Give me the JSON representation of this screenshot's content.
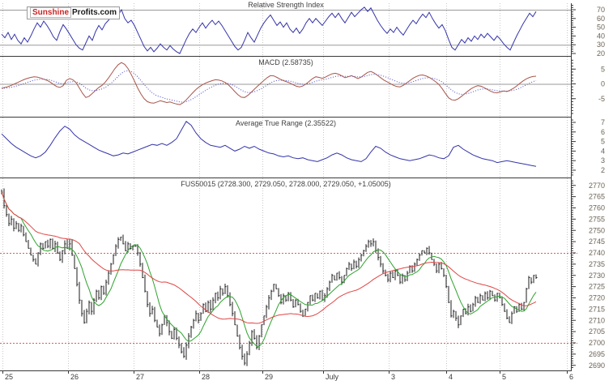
{
  "logo": {
    "part1": "Sunshine",
    "part2": "Profits.com"
  },
  "colors": {
    "rsi_line": "#3434aa",
    "macd_line": "#a8554a",
    "macd_signal": "#4747cc",
    "atr_line": "#3434aa",
    "price_bar": "#1b1b1b",
    "ma_fast": "#2da32d",
    "ma_slow": "#e04545",
    "hline": "#d85c5c",
    "ref_line": "#9a9a9a",
    "grid_line": "#c8c8c8",
    "separator": "#3a3a3a",
    "axis": "#3a3a3a",
    "tick_label": "#6b6255",
    "date_label": "#3a3a3a"
  },
  "x_axis": {
    "labels": [
      "25",
      "26",
      "27",
      "28",
      "29",
      "July",
      "3",
      "4",
      "5",
      "6"
    ],
    "positions": [
      3,
      84,
      165,
      246,
      324,
      399,
      480,
      551,
      617,
      700
    ]
  },
  "chart_data": [
    {
      "type": "line",
      "panel": "rsi",
      "title": "Relative Strength Index",
      "ylim": [
        18,
        75
      ],
      "yticks": [
        70,
        60,
        50,
        40,
        30,
        20
      ],
      "ref_lines": [
        70,
        30
      ],
      "grid": "vertical-dotted",
      "legend_position": "none",
      "series": [
        {
          "name": "RSI",
          "color_key": "rsi_line",
          "x0": 2,
          "dx": 4,
          "values": [
            42,
            38,
            44,
            36,
            42,
            35,
            31,
            38,
            33,
            40,
            48,
            55,
            50,
            57,
            52,
            46,
            39,
            35,
            45,
            53,
            48,
            42,
            36,
            30,
            26,
            24,
            32,
            40,
            35,
            45,
            52,
            47,
            54,
            58,
            63,
            68,
            64,
            70,
            60,
            55,
            58,
            52,
            44,
            36,
            28,
            23,
            27,
            22,
            26,
            31,
            27,
            24,
            29,
            25,
            22,
            20,
            28,
            36,
            43,
            48,
            44,
            50,
            55,
            49,
            54,
            58,
            53,
            57,
            52,
            46,
            40,
            34,
            28,
            24,
            27,
            35,
            44,
            38,
            33,
            41,
            49,
            55,
            60,
            64,
            58,
            52,
            56,
            50,
            55,
            48,
            44,
            49,
            43,
            48,
            55,
            60,
            55,
            60,
            56,
            52,
            57,
            62,
            66,
            61,
            66,
            60,
            55,
            61,
            67,
            62,
            66,
            70,
            73,
            68,
            72,
            65,
            58,
            52,
            47,
            43,
            48,
            44,
            50,
            45,
            41,
            47,
            53,
            58,
            54,
            60,
            65,
            61,
            67,
            60,
            54,
            49,
            53,
            46,
            36,
            27,
            24,
            30,
            36,
            32,
            38,
            34,
            40,
            36,
            42,
            38,
            43,
            39,
            35,
            40,
            36,
            31,
            27,
            24,
            32,
            40,
            47,
            54,
            60,
            66,
            62,
            68
          ]
        }
      ]
    },
    {
      "type": "line",
      "panel": "macd",
      "title": "MACD (2.58735)",
      "current_value": 2.58735,
      "ylim": [
        -10,
        10
      ],
      "yticks": [
        5,
        0,
        -5
      ],
      "ref_lines": [
        0
      ],
      "legend_position": "none",
      "series": [
        {
          "name": "MACD line",
          "color_key": "macd_line",
          "x0": 2,
          "dx": 4,
          "values": [
            -1.5,
            -1.2,
            -0.9,
            -0.5,
            0.0,
            0.5,
            1.0,
            1.5,
            1.9,
            2.2,
            2.4,
            2.3,
            2.0,
            1.6,
            1.2,
            0.6,
            -0.2,
            -0.9,
            -1.2,
            -0.6,
            1.2,
            1.8,
            1.4,
            0.4,
            -1.4,
            -3.2,
            -4.6,
            -4.2,
            -3.2,
            -2.2,
            -1.2,
            -0.5,
            0.6,
            2.0,
            3.6,
            5.2,
            6.5,
            7.2,
            6.6,
            5.2,
            3.2,
            1.0,
            -1.4,
            -3.4,
            -5.0,
            -6.0,
            -6.4,
            -6.5,
            -6.1,
            -5.7,
            -6.0,
            -6.3,
            -6.1,
            -6.5,
            -6.8,
            -7.0,
            -6.4,
            -5.4,
            -4.2,
            -3.0,
            -1.9,
            -1.0,
            -0.3,
            0.3,
            0.7,
            1.1,
            1.4,
            1.3,
            1.0,
            0.5,
            -0.3,
            -1.4,
            -2.6,
            -3.7,
            -4.5,
            -4.6,
            -3.9,
            -2.9,
            -1.8,
            -0.8,
            0.2,
            1.2,
            2.1,
            2.8,
            2.7,
            2.2,
            1.6,
            1.1,
            0.7,
            0.3,
            -0.3,
            -0.8,
            -1.0,
            -0.7,
            0.0,
            0.9,
            1.8,
            2.4,
            2.2,
            1.9,
            2.3,
            2.9,
            3.4,
            3.6,
            3.3,
            2.7,
            2.1,
            2.4,
            2.8,
            2.3,
            1.8,
            2.3,
            3.1,
            3.9,
            4.2,
            3.7,
            2.9,
            2.1,
            1.3,
            0.7,
            0.1,
            -0.5,
            -0.9,
            -1.0,
            -0.5,
            0.3,
            1.1,
            1.9,
            2.5,
            2.9,
            3.0,
            2.7,
            2.2,
            1.5,
            0.7,
            -0.2,
            -1.6,
            -3.2,
            -4.7,
            -5.4,
            -5.5,
            -5.0,
            -4.2,
            -3.3,
            -2.4,
            -1.6,
            -1.0,
            -0.6,
            -0.8,
            -1.3,
            -1.9,
            -2.5,
            -2.9,
            -3.0,
            -2.7,
            -2.4,
            -2.6,
            -2.1,
            -1.5,
            -0.7,
            0.2,
            1.0,
            1.7,
            2.2,
            2.5,
            2.6
          ]
        },
        {
          "name": "signal line",
          "type": "derived_ema",
          "alpha": 0.22,
          "color_key": "macd_signal",
          "dash": "1 2"
        }
      ]
    },
    {
      "type": "line",
      "panel": "atr",
      "title": "Average True Range (2.35522)",
      "current_value": 2.35522,
      "ylim": [
        1.9,
        7.5
      ],
      "yticks": [
        7,
        6,
        5,
        4,
        3,
        2
      ],
      "ref_lines": [],
      "legend_position": "none",
      "series": [
        {
          "name": "ATR",
          "color_key": "atr_line",
          "x0": 2,
          "dx": 6,
          "values": [
            5.8,
            5.3,
            4.8,
            4.4,
            4.1,
            3.8,
            3.5,
            3.3,
            3.5,
            3.9,
            4.6,
            5.4,
            6.1,
            6.6,
            6.3,
            5.7,
            5.3,
            5.0,
            4.7,
            4.4,
            4.1,
            3.9,
            3.7,
            3.5,
            3.6,
            3.8,
            3.7,
            3.9,
            4.1,
            4.3,
            4.5,
            4.7,
            4.6,
            4.8,
            4.6,
            4.9,
            5.3,
            6.2,
            7.1,
            6.7,
            5.9,
            5.3,
            4.9,
            4.6,
            4.5,
            4.4,
            4.6,
            4.3,
            4.0,
            4.2,
            4.5,
            4.3,
            4.5,
            4.2,
            4.0,
            3.8,
            3.7,
            3.5,
            3.4,
            3.5,
            3.3,
            3.2,
            3.3,
            3.1,
            3.0,
            2.9,
            3.1,
            3.3,
            3.6,
            3.8,
            3.6,
            3.3,
            3.1,
            3.0,
            2.9,
            3.2,
            3.9,
            4.5,
            4.3,
            3.9,
            3.6,
            3.4,
            3.2,
            3.1,
            3.0,
            3.1,
            3.2,
            3.4,
            3.6,
            3.5,
            3.3,
            3.2,
            3.5,
            4.4,
            4.6,
            4.2,
            3.9,
            3.6,
            3.4,
            3.2,
            3.1,
            3.0,
            2.8,
            2.9,
            3.0,
            2.9,
            2.8,
            2.7,
            2.6,
            2.5,
            2.4
          ]
        }
      ]
    },
    {
      "type": "ohlc",
      "panel": "price",
      "title": "FUS50015 (2728.300, 2729.050, 2728.000, 2729.050, +1.05005)",
      "symbol": "FUS50015",
      "last_values": {
        "open": "2728.300",
        "high": "2729.050",
        "low": "2728.000",
        "close": "2729.050",
        "change": "+1.05005"
      },
      "ylim": [
        2688,
        2772
      ],
      "yticks": [
        2770,
        2765,
        2760,
        2755,
        2750,
        2745,
        2740,
        2735,
        2730,
        2725,
        2720,
        2715,
        2710,
        2705,
        2700,
        2695,
        2690
      ],
      "hlines": [
        {
          "value": 2740,
          "style": "dotted"
        },
        {
          "value": 2700,
          "style": "dotted"
        }
      ],
      "legend_position": "none",
      "series": [
        {
          "name": "FUS500 15-min bars",
          "type": "bars",
          "color_key": "price_bar",
          "x0": 2,
          "dx": 3,
          "closes": [
            2767,
            2761,
            2757,
            2753,
            2755,
            2751,
            2753,
            2750,
            2752,
            2748,
            2745,
            2742,
            2739,
            2737,
            2735,
            2740,
            2744,
            2742,
            2745,
            2743,
            2746,
            2742,
            2744,
            2740,
            2737,
            2741,
            2744,
            2742,
            2744,
            2739,
            2733,
            2726,
            2719,
            2713,
            2709,
            2714,
            2718,
            2714,
            2719,
            2723,
            2720,
            2725,
            2722,
            2727,
            2731,
            2735,
            2739,
            2743,
            2746,
            2747,
            2744,
            2741,
            2744,
            2742,
            2743,
            2743,
            2740,
            2735,
            2729,
            2723,
            2717,
            2713,
            2715,
            2710,
            2707,
            2704,
            2708,
            2712,
            2709,
            2705,
            2702,
            2706,
            2702,
            2699,
            2696,
            2694,
            2699,
            2703,
            2707,
            2710,
            2713,
            2710,
            2713,
            2717,
            2714,
            2718,
            2715,
            2719,
            2722,
            2720,
            2724,
            2722,
            2725,
            2721,
            2717,
            2713,
            2708,
            2703,
            2698,
            2694,
            2691,
            2695,
            2700,
            2705,
            2702,
            2698,
            2703,
            2708,
            2712,
            2716,
            2720,
            2723,
            2726,
            2724,
            2721,
            2718,
            2721,
            2719,
            2722,
            2719,
            2716,
            2719,
            2717,
            2714,
            2712,
            2715,
            2718,
            2721,
            2719,
            2722,
            2720,
            2723,
            2719,
            2721,
            2724,
            2727,
            2730,
            2728,
            2731,
            2729,
            2727,
            2730,
            2733,
            2735,
            2733,
            2736,
            2734,
            2737,
            2739,
            2741,
            2743,
            2745,
            2744,
            2745,
            2741,
            2738,
            2735,
            2732,
            2730,
            2728,
            2731,
            2729,
            2732,
            2730,
            2727,
            2730,
            2728,
            2731,
            2734,
            2732,
            2735,
            2737,
            2739,
            2741,
            2740,
            2742,
            2740,
            2737,
            2735,
            2732,
            2735,
            2733,
            2730,
            2725,
            2718,
            2712,
            2714,
            2711,
            2708,
            2712,
            2715,
            2713,
            2716,
            2714,
            2717,
            2720,
            2718,
            2721,
            2719,
            2722,
            2720,
            2723,
            2721,
            2719,
            2722,
            2720,
            2717,
            2714,
            2711,
            2709,
            2713,
            2716,
            2714,
            2717,
            2715,
            2718,
            2724,
            2729,
            2727,
            2730,
            2729
          ]
        },
        {
          "name": "fast moving average",
          "type": "derived_sma",
          "window": 9,
          "color_key": "ma_fast"
        },
        {
          "name": "slow moving average",
          "type": "derived_sma",
          "window": 33,
          "color_key": "ma_slow"
        }
      ]
    }
  ]
}
